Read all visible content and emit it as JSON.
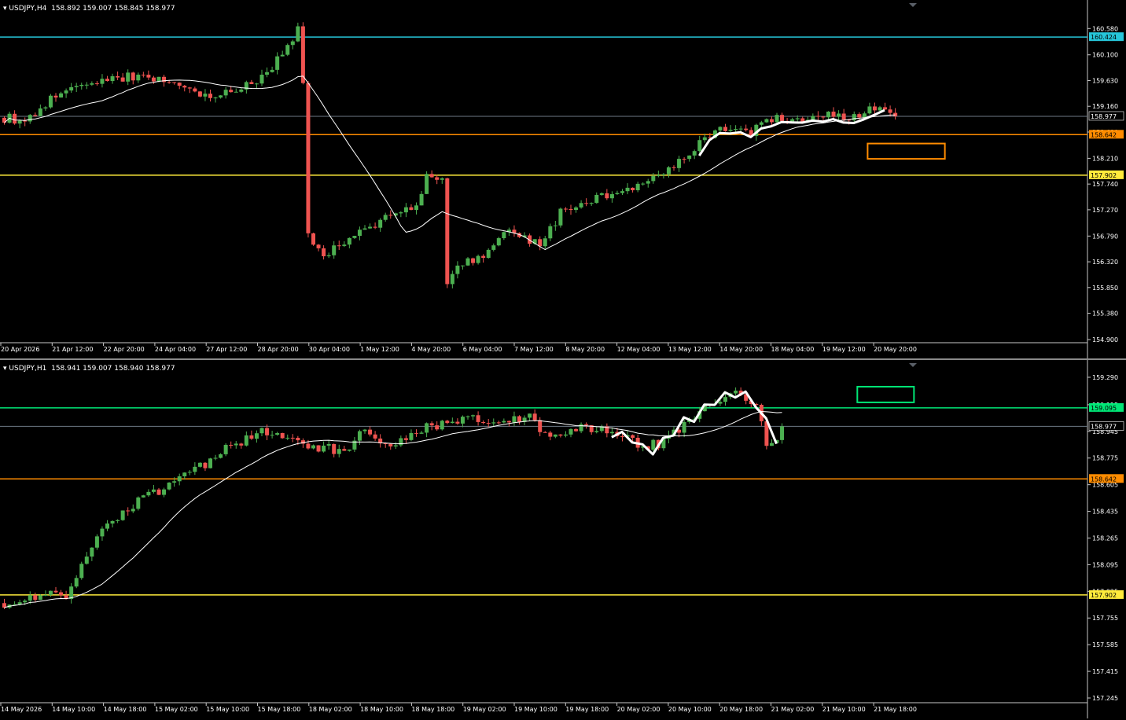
{
  "colors": {
    "background": "#000000",
    "axis": "#c8c8c8",
    "text": "#ffffff",
    "bull": "#4caf50",
    "bear": "#ef5350",
    "ma": "#ffffff",
    "current_price_line": "#6e7a86"
  },
  "icons": {
    "dropdown": "triangle-down-icon",
    "shift_marker": "triangle-down-icon"
  },
  "chart_data": [
    {
      "type": "candlestick",
      "symbol": "USDJPY,H4",
      "ohlc_label": "158.892 159.007 158.845 158.977",
      "y_axis": {
        "min": 154.9,
        "max": 160.9,
        "ticks": [
          "160.580",
          "160.100",
          "159.630",
          "159.160",
          "158.690",
          "158.210",
          "157.740",
          "157.270",
          "156.790",
          "156.320",
          "155.850",
          "155.380",
          "154.900"
        ]
      },
      "x_ticks": [
        "20 Apr 2026",
        "21 Apr 12:00",
        "22 Apr 20:00",
        "24 Apr 04:00",
        "27 Apr 12:00",
        "28 Apr 20:00",
        "30 Apr 04:00",
        "1 May 12:00",
        "4 May 20:00",
        "6 May 04:00",
        "7 May 12:00",
        "8 May 20:00",
        "12 May 04:00",
        "13 May 12:00",
        "14 May 20:00",
        "18 May 04:00",
        "19 May 12:00",
        "20 May 20:00"
      ],
      "current_price": {
        "value": 158.977,
        "label": "158.977"
      },
      "levels": [
        {
          "value": 160.424,
          "label": "160.424",
          "color": "#26c6da"
        },
        {
          "value": 158.642,
          "label": "158.642",
          "color": "#ff8c00"
        },
        {
          "value": 157.902,
          "label": "157.902",
          "color": "#ffeb3b"
        }
      ],
      "box": {
        "from_index": 168,
        "to_index": 183,
        "y_top": 158.48,
        "y_bottom": 158.2,
        "color": "#ff8c00"
      },
      "ma_period": 20,
      "keypoints": [
        [
          0,
          158.95
        ],
        [
          4,
          158.9
        ],
        [
          10,
          159.35
        ],
        [
          16,
          159.55
        ],
        [
          22,
          159.7
        ],
        [
          28,
          159.7
        ],
        [
          34,
          159.55
        ],
        [
          40,
          159.35
        ],
        [
          46,
          159.45
        ],
        [
          52,
          159.85
        ],
        [
          55,
          160.25
        ],
        [
          57,
          160.55
        ],
        [
          58,
          159.55
        ],
        [
          59,
          156.8
        ],
        [
          62,
          156.4
        ],
        [
          66,
          156.7
        ],
        [
          70,
          156.9
        ],
        [
          76,
          157.25
        ],
        [
          80,
          157.3
        ],
        [
          82,
          157.85
        ],
        [
          85,
          157.85
        ],
        [
          86,
          155.95
        ],
        [
          88,
          156.2
        ],
        [
          94,
          156.5
        ],
        [
          98,
          156.95
        ],
        [
          104,
          156.6
        ],
        [
          108,
          157.2
        ],
        [
          114,
          157.45
        ],
        [
          120,
          157.65
        ],
        [
          126,
          157.85
        ],
        [
          132,
          158.2
        ],
        [
          138,
          158.75
        ],
        [
          144,
          158.65
        ],
        [
          150,
          158.95
        ],
        [
          156,
          158.85
        ],
        [
          160,
          159.05
        ],
        [
          165,
          158.95
        ],
        [
          170,
          159.2
        ],
        [
          173,
          158.977
        ]
      ]
    },
    {
      "type": "candlestick",
      "symbol": "USDJPY,H1",
      "ohlc_label": "158.941 159.007 158.940 158.977",
      "y_axis": {
        "min": 157.235,
        "max": 159.33,
        "ticks": [
          "159.290",
          "159.115",
          "158.945",
          "158.775",
          "158.605",
          "158.435",
          "158.265",
          "158.095",
          "157.925",
          "157.755",
          "157.585",
          "157.415",
          "157.245"
        ]
      },
      "x_ticks": [
        "14 May 2026",
        "14 May 10:00",
        "14 May 18:00",
        "15 May 02:00",
        "15 May 10:00",
        "15 May 18:00",
        "18 May 02:00",
        "18 May 10:00",
        "18 May 18:00",
        "19 May 02:00",
        "19 May 10:00",
        "19 May 18:00",
        "20 May 02:00",
        "20 May 10:00",
        "20 May 18:00",
        "21 May 02:00",
        "21 May 10:00",
        "21 May 18:00"
      ],
      "current_price": {
        "value": 158.977,
        "label": "158.977"
      },
      "levels": [
        {
          "value": 159.095,
          "label": "159.095",
          "color": "#00e676"
        },
        {
          "value": 158.642,
          "label": "158.642",
          "color": "#ff8c00"
        },
        {
          "value": 157.902,
          "label": "157.902",
          "color": "#ffeb3b"
        }
      ],
      "box": {
        "from_index": 166,
        "to_index": 177,
        "y_top": 159.23,
        "y_bottom": 159.13,
        "color": "#00e676"
      },
      "ma_period": 20,
      "keypoints": [
        [
          0,
          157.85
        ],
        [
          6,
          157.9
        ],
        [
          12,
          157.9
        ],
        [
          16,
          158.15
        ],
        [
          20,
          158.35
        ],
        [
          26,
          158.5
        ],
        [
          32,
          158.6
        ],
        [
          38,
          158.72
        ],
        [
          44,
          158.85
        ],
        [
          50,
          158.95
        ],
        [
          54,
          158.9
        ],
        [
          60,
          158.85
        ],
        [
          66,
          158.82
        ],
        [
          70,
          158.95
        ],
        [
          74,
          158.85
        ],
        [
          80,
          158.95
        ],
        [
          86,
          159.0
        ],
        [
          90,
          159.05
        ],
        [
          96,
          159.0
        ],
        [
          102,
          159.03
        ],
        [
          106,
          158.9
        ],
        [
          112,
          158.97
        ],
        [
          118,
          158.95
        ],
        [
          124,
          158.85
        ],
        [
          128,
          158.87
        ],
        [
          132,
          159.0
        ],
        [
          138,
          159.15
        ],
        [
          142,
          159.2
        ],
        [
          146,
          159.1
        ],
        [
          148,
          158.88
        ],
        [
          150,
          158.92
        ],
        [
          151,
          158.977
        ]
      ]
    }
  ]
}
